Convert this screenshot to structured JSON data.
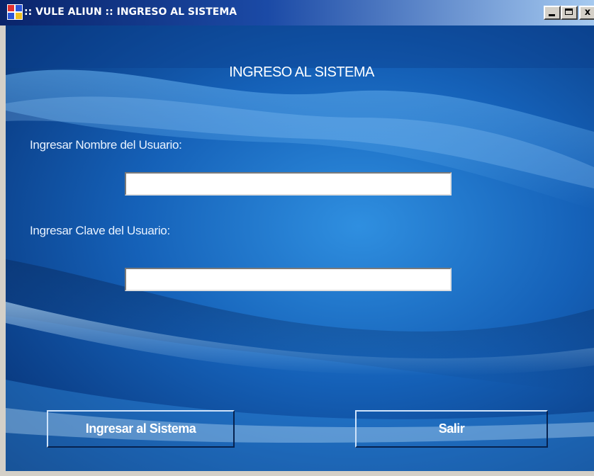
{
  "window": {
    "title": ":: VULE ALIUN :: INGRESO AL SISTEMA",
    "controls": {
      "minimize": "minimize-button",
      "maximize": "maximize-button",
      "close_label": "x"
    }
  },
  "form": {
    "heading": "INGRESO AL SISTEMA",
    "username_label": "Ingresar Nombre del Usuario:",
    "username_value": "",
    "password_label": "Ingresar Clave del Usuario:",
    "password_value": "",
    "login_button_label": "Ingresar al Sistema",
    "exit_button_label": "Salir"
  },
  "colors": {
    "titlebar_start": "#0a246a",
    "background_blue": "#1561b8",
    "text": "#ffffff"
  },
  "icons": {
    "app": "app-icon",
    "minimize": "minimize-icon",
    "maximize": "maximize-icon",
    "close": "close-icon"
  }
}
